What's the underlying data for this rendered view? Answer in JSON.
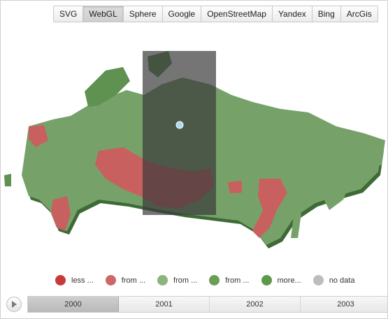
{
  "toolbar": {
    "buttons": [
      {
        "label": "SVG",
        "active": false
      },
      {
        "label": "WebGL",
        "active": true
      },
      {
        "label": "Sphere",
        "active": false
      },
      {
        "label": "Google",
        "active": false
      },
      {
        "label": "OpenStreetMap",
        "active": false
      },
      {
        "label": "Yandex",
        "active": false
      },
      {
        "label": "Bing",
        "active": false
      },
      {
        "label": "ArcGis",
        "active": false
      }
    ]
  },
  "legend": {
    "items": [
      {
        "label": "less ...",
        "color": "#c83a3a"
      },
      {
        "label": "from ...",
        "color": "#cf6666"
      },
      {
        "label": "from ...",
        "color": "#8cb47c"
      },
      {
        "label": "from ...",
        "color": "#6a9e55"
      },
      {
        "label": "more...",
        "color": "#5c9a4a"
      },
      {
        "label": "no data",
        "color": "#bdbdbd"
      }
    ]
  },
  "timeline": {
    "years": [
      "2000",
      "2001",
      "2002",
      "2003"
    ],
    "selected": "2000"
  },
  "colors": {
    "map_green": "#76a26a",
    "map_green_dark": "#4f7c45",
    "map_red": "#c86060",
    "selection_overlay": "#3a3a3a",
    "marker": "#a8dcec"
  }
}
